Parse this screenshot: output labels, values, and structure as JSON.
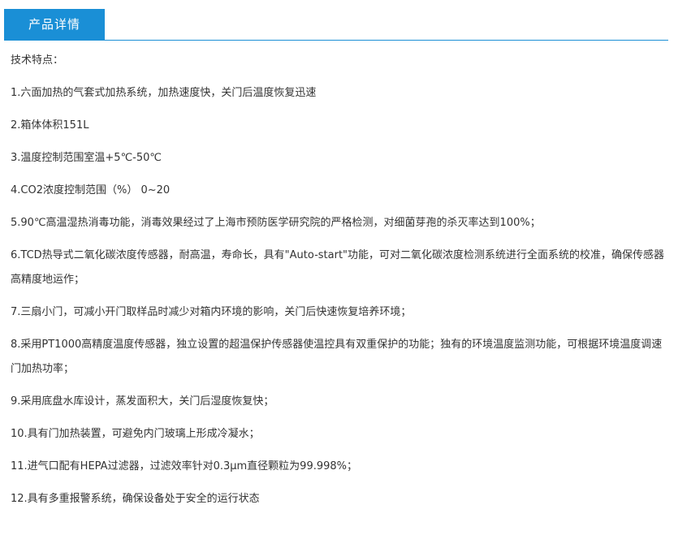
{
  "tabs": {
    "active_label": "产品详情"
  },
  "content": {
    "heading": "技术特点：",
    "items": [
      "1.六面加热的气套式加热系统，加热速度快，关门后温度恢复迅速",
      "2.箱体体积151L",
      "3.温度控制范围室温+5℃-50℃",
      "4.CO2浓度控制范围（%） 0~20",
      "5.90℃高温湿热消毒功能，消毒效果经过了上海市预防医学研究院的严格检测，对细菌芽孢的杀灭率达到100%；",
      "6.TCD热导式二氧化碳浓度传感器，耐高温，寿命长，具有\"Auto-start\"功能，可对二氧化碳浓度检测系统进行全面系统的校准，确保传感器高精度地运作；",
      "7.三扇小门，可减小开门取样品时减少对箱内环境的影响，关门后快速恢复培养环境；",
      "8.采用PT1000高精度温度传感器，独立设置的超温保护传感器使温控具有双重保护的功能；独有的环境温度监测功能，可根据环境温度调速门加热功率；",
      "9.采用底盘水库设计，蒸发面积大，关门后湿度恢复快；",
      "10.具有门加热装置，可避免内门玻璃上形成冷凝水；",
      "11.进气口配有HEPA过滤器，过滤效率针对0.3μm直径颗粒为99.998%；",
      "12.具有多重报警系统，确保设备处于安全的运行状态"
    ]
  },
  "colors": {
    "accent": "#1a8fd6",
    "text": "#333333"
  }
}
